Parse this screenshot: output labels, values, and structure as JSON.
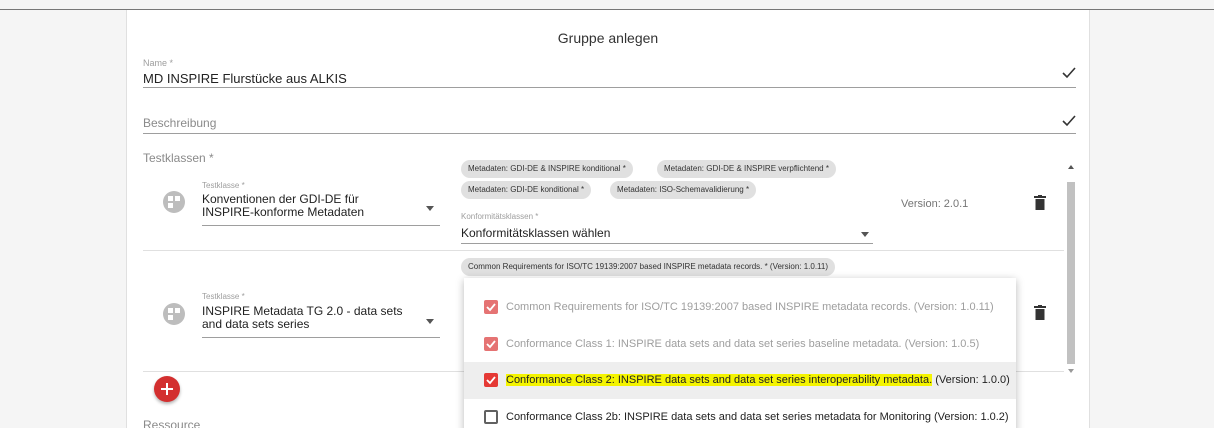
{
  "dialog": {
    "title": "Gruppe anlegen"
  },
  "name": {
    "label": "Name *",
    "value": "MD INSPIRE Flurstücke aus ALKIS"
  },
  "beschreibung": {
    "label": "Beschreibung"
  },
  "testklassen": {
    "label": "Testklassen *",
    "rows": [
      {
        "testklasse_label": "Testklasse *",
        "testklasse_value": "Konventionen der GDI-DE für INSPIRE-konforme Metadaten",
        "chips": [
          "Metadaten: GDI-DE & INSPIRE konditional *",
          "Metadaten: GDI-DE & INSPIRE verpflichtend *",
          "Metadaten: GDI-DE konditional *",
          "Metadaten: ISO-Schemavalidierung *"
        ],
        "konformitaet_label": "Konformitätsklassen *",
        "konformitaet_value": "Konformitätsklassen wählen",
        "version": "Version: 2.0.1"
      },
      {
        "testklasse_label": "Testklasse *",
        "testklasse_value": "INSPIRE Metadata TG 2.0 - data sets and data sets series",
        "chips": [
          "Common Requirements for ISO/TC 19139:2007 based INSPIRE metadata records. * (Version: 1.0.11)"
        ]
      }
    ]
  },
  "dropdown": {
    "options": [
      {
        "text": "Common Requirements for ISO/TC 19139:2007 based INSPIRE metadata records. (Version: 1.0.11)",
        "checked": true,
        "disabled": true
      },
      {
        "text": "Conformance Class 1: INSPIRE data sets and data set series baseline metadata. (Version: 1.0.5)",
        "checked": true,
        "disabled": true
      },
      {
        "text_highlighted": "Conformance Class 2: INSPIRE data sets and data set series interoperability metadata.",
        "text_rest": " (Version: 1.0.0)",
        "checked": true,
        "disabled": false,
        "highlighted": true
      },
      {
        "text": "Conformance Class 2b: INSPIRE data sets and data set series metadata for Monitoring (Version: 1.0.2)",
        "checked": false,
        "disabled": false
      }
    ]
  },
  "ressource": {
    "label": "Ressource"
  },
  "colors": {
    "accent": "#d32f2f",
    "checkbox_disabled": "#e57373",
    "highlight": "#f4f400"
  },
  "icons": [
    "check-icon",
    "test-class-icon",
    "trash-icon",
    "add-icon",
    "caret-down-icon",
    "checkbox-icon"
  ]
}
